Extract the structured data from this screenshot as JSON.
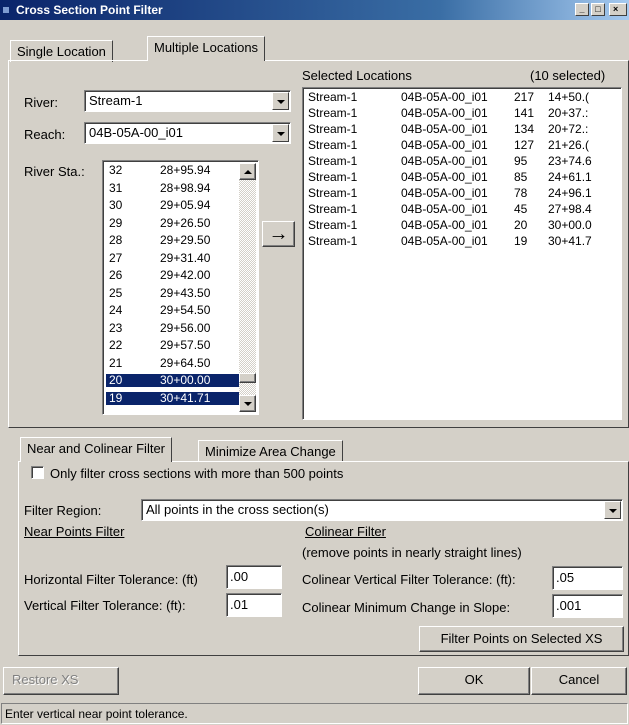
{
  "window": {
    "title": "Cross Section Point Filter",
    "controls": [
      "minimize",
      "maximize",
      "close"
    ]
  },
  "top_tabs": [
    {
      "label": "Single Location",
      "active": false
    },
    {
      "label": "Multiple Locations",
      "active": true
    }
  ],
  "location": {
    "river_label": "River:",
    "river_value": "Stream-1",
    "reach_label": "Reach:",
    "reach_value": "04B-05A-00_i01",
    "station_label": "River Sta.:"
  },
  "stations": [
    {
      "num": "32",
      "sta": "28+95.94",
      "selected": false
    },
    {
      "num": "31",
      "sta": "28+98.94",
      "selected": false
    },
    {
      "num": "30",
      "sta": "29+05.94",
      "selected": false
    },
    {
      "num": "29",
      "sta": "29+26.50",
      "selected": false
    },
    {
      "num": "28",
      "sta": "29+29.50",
      "selected": false
    },
    {
      "num": "27",
      "sta": "29+31.40",
      "selected": false
    },
    {
      "num": "26",
      "sta": "29+42.00",
      "selected": false
    },
    {
      "num": "25",
      "sta": "29+43.50",
      "selected": false
    },
    {
      "num": "24",
      "sta": "29+54.50",
      "selected": false
    },
    {
      "num": "23",
      "sta": "29+56.00",
      "selected": false
    },
    {
      "num": "22",
      "sta": "29+57.50",
      "selected": false
    },
    {
      "num": "21",
      "sta": "29+64.50",
      "selected": false
    },
    {
      "num": "20",
      "sta": "30+00.00",
      "selected": true
    },
    {
      "num": "19",
      "sta": "30+41.71",
      "selected": true
    }
  ],
  "add_arrow": "→",
  "selected_locations": {
    "header": "Selected Locations",
    "count_text": "(10 selected)",
    "rows": [
      {
        "river": "Stream-1",
        "reach": "04B-05A-00_i01",
        "num": "217",
        "sta": "14+50.("
      },
      {
        "river": "Stream-1",
        "reach": "04B-05A-00_i01",
        "num": "141",
        "sta": "20+37.:"
      },
      {
        "river": "Stream-1",
        "reach": "04B-05A-00_i01",
        "num": "134",
        "sta": "20+72.:"
      },
      {
        "river": "Stream-1",
        "reach": "04B-05A-00_i01",
        "num": "127",
        "sta": "21+26.("
      },
      {
        "river": "Stream-1",
        "reach": "04B-05A-00_i01",
        "num": "95",
        "sta": "23+74.6"
      },
      {
        "river": "Stream-1",
        "reach": "04B-05A-00_i01",
        "num": "85",
        "sta": "24+61.1"
      },
      {
        "river": "Stream-1",
        "reach": "04B-05A-00_i01",
        "num": "78",
        "sta": "24+96.1"
      },
      {
        "river": "Stream-1",
        "reach": "04B-05A-00_i01",
        "num": "45",
        "sta": "27+98.4"
      },
      {
        "river": "Stream-1",
        "reach": "04B-05A-00_i01",
        "num": "20",
        "sta": "30+00.0"
      },
      {
        "river": "Stream-1",
        "reach": "04B-05A-00_i01",
        "num": "19",
        "sta": "30+41.7"
      }
    ]
  },
  "filter_tabs": [
    {
      "label": "Near and Colinear Filter",
      "active": true
    },
    {
      "label": "Minimize Area Change",
      "active": false
    }
  ],
  "filter": {
    "only_filter_label": "Only filter cross sections with more than 500 points",
    "only_filter_checked": false,
    "region_label": "Filter Region:",
    "region_value": "All points in the cross section(s)",
    "near_heading": "Near Points Filter",
    "colinear_heading": "Colinear Filter",
    "colinear_note": "(remove points in nearly straight lines)",
    "horizontal_label": "Horizontal Filter Tolerance: (ft)",
    "horizontal_value": ".00",
    "vertical_label": "Vertical Filter Tolerance: (ft):",
    "vertical_value": ".01",
    "colinear_vertical_label": "Colinear Vertical Filter Tolerance: (ft):",
    "colinear_vertical_value": ".05",
    "colinear_slope_label": "Colinear Minimum Change in Slope:",
    "colinear_slope_value": ".001",
    "filter_button": "Filter Points on Selected XS"
  },
  "footer": {
    "restore": "Restore XS",
    "ok": "OK",
    "cancel": "Cancel"
  },
  "status": "Enter vertical near point tolerance."
}
